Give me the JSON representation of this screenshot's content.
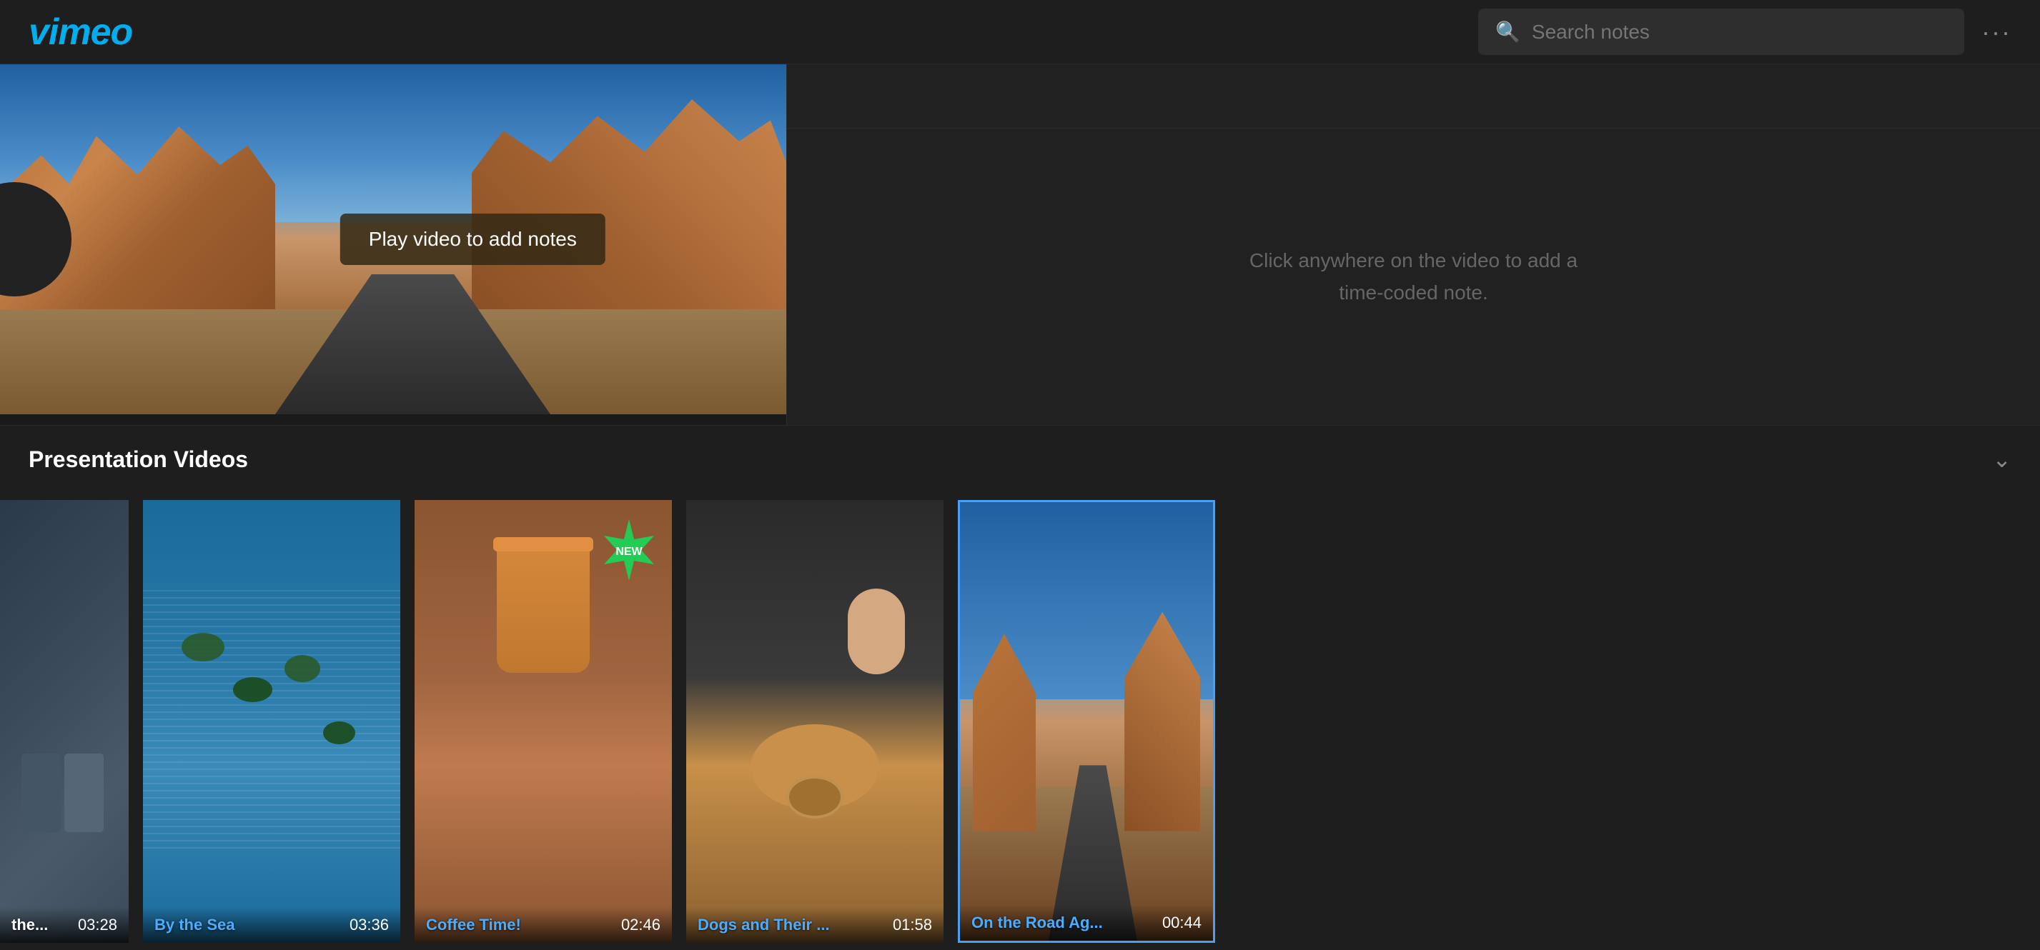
{
  "header": {
    "logo": "vimeo",
    "search": {
      "placeholder": "Search notes",
      "value": ""
    },
    "more_label": "···"
  },
  "video": {
    "play_tooltip": "Play video to add notes",
    "notes_empty_text": "Click anywhere on the video to\nadd a time-coded note."
  },
  "playlist": {
    "title": "Presentation Videos",
    "chevron": "⌄",
    "items": [
      {
        "title": "the...",
        "duration": "03:28",
        "title_color": "white"
      },
      {
        "title": "By the Sea",
        "duration": "03:36",
        "title_color": "blue"
      },
      {
        "title": "Coffee Time!",
        "duration": "02:46",
        "title_color": "blue",
        "badge": "NEW"
      },
      {
        "title": "Dogs and Their ...",
        "duration": "01:58",
        "title_color": "blue"
      },
      {
        "title": "On the Road Ag...",
        "duration": "00:44",
        "title_color": "blue",
        "active": true
      }
    ]
  },
  "colors": {
    "bg_dark": "#1a1a1a",
    "bg_medium": "#1e1e1e",
    "bg_panel": "#212121",
    "accent_blue": "#00adef",
    "active_border": "#4a9ff5",
    "text_muted": "#666666",
    "text_blue_link": "#4aadff"
  }
}
